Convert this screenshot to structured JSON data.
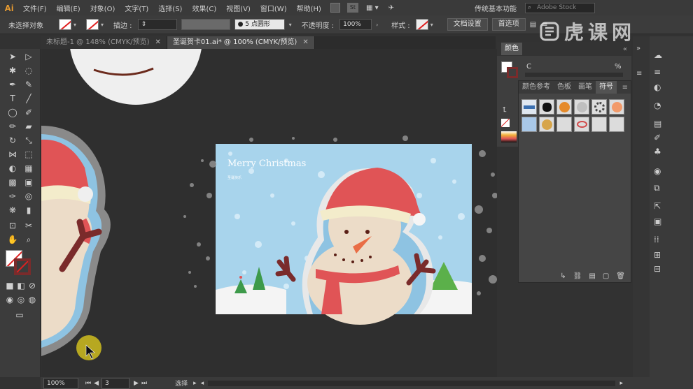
{
  "menubar": {
    "logo": "Ai",
    "items": [
      "文件(F)",
      "编辑(E)",
      "对象(O)",
      "文字(T)",
      "选择(S)",
      "效果(C)",
      "视图(V)",
      "窗口(W)",
      "帮助(H)"
    ],
    "st_label": "St",
    "workspace": "传统基本功能",
    "search_placeholder": "Adobe Stock"
  },
  "control_bar": {
    "selection_label": "未选择对象",
    "stroke_label": "描边 :",
    "brush_value": "5 点圆形",
    "opacity_label": "不透明度 :",
    "opacity_value": "100%",
    "style_label": "样式 :",
    "doc_setup_button": "文档设置",
    "preferences_button": "首选项"
  },
  "watermark": {
    "text": "虎课网"
  },
  "tabs": [
    {
      "label": "未标题-1 @ 148% (CMYK/预览)",
      "active": false
    },
    {
      "label": "圣诞贺卡01.ai* @ 100% (CMYK/预览)",
      "active": true
    }
  ],
  "color_panel": {
    "title": "颜色",
    "channel_label": "C",
    "channel_unit": "%"
  },
  "swatch_panel": {
    "tabs": [
      "颜色参考",
      "色板",
      "画笔",
      "符号"
    ],
    "active_tab": "符号"
  },
  "artwork": {
    "card_title": "Merry Christmas",
    "card_subtitle": "圣诞快乐"
  },
  "status_bar": {
    "zoom": "100%",
    "page": "3",
    "mode": "选择"
  },
  "colors": {
    "accent_red": "#e05456",
    "sky_blue": "#a8d4ec",
    "snowman_body": "#ecdcc8",
    "branch_brown": "#7a2b2b"
  }
}
